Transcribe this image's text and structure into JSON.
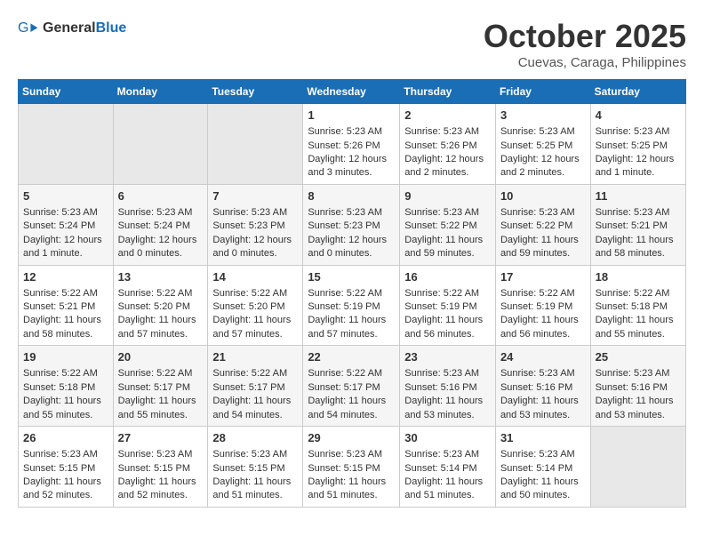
{
  "logo": {
    "general": "General",
    "blue": "Blue"
  },
  "header": {
    "month": "October 2025",
    "location": "Cuevas, Caraga, Philippines"
  },
  "weekdays": [
    "Sunday",
    "Monday",
    "Tuesday",
    "Wednesday",
    "Thursday",
    "Friday",
    "Saturday"
  ],
  "weeks": [
    [
      {
        "day": "",
        "empty": true
      },
      {
        "day": "",
        "empty": true
      },
      {
        "day": "",
        "empty": true
      },
      {
        "day": "1",
        "sunrise": "Sunrise: 5:23 AM",
        "sunset": "Sunset: 5:26 PM",
        "daylight": "Daylight: 12 hours and 3 minutes."
      },
      {
        "day": "2",
        "sunrise": "Sunrise: 5:23 AM",
        "sunset": "Sunset: 5:26 PM",
        "daylight": "Daylight: 12 hours and 2 minutes."
      },
      {
        "day": "3",
        "sunrise": "Sunrise: 5:23 AM",
        "sunset": "Sunset: 5:25 PM",
        "daylight": "Daylight: 12 hours and 2 minutes."
      },
      {
        "day": "4",
        "sunrise": "Sunrise: 5:23 AM",
        "sunset": "Sunset: 5:25 PM",
        "daylight": "Daylight: 12 hours and 1 minute."
      }
    ],
    [
      {
        "day": "5",
        "sunrise": "Sunrise: 5:23 AM",
        "sunset": "Sunset: 5:24 PM",
        "daylight": "Daylight: 12 hours and 1 minute."
      },
      {
        "day": "6",
        "sunrise": "Sunrise: 5:23 AM",
        "sunset": "Sunset: 5:24 PM",
        "daylight": "Daylight: 12 hours and 0 minutes."
      },
      {
        "day": "7",
        "sunrise": "Sunrise: 5:23 AM",
        "sunset": "Sunset: 5:23 PM",
        "daylight": "Daylight: 12 hours and 0 minutes."
      },
      {
        "day": "8",
        "sunrise": "Sunrise: 5:23 AM",
        "sunset": "Sunset: 5:23 PM",
        "daylight": "Daylight: 12 hours and 0 minutes."
      },
      {
        "day": "9",
        "sunrise": "Sunrise: 5:23 AM",
        "sunset": "Sunset: 5:22 PM",
        "daylight": "Daylight: 11 hours and 59 minutes."
      },
      {
        "day": "10",
        "sunrise": "Sunrise: 5:23 AM",
        "sunset": "Sunset: 5:22 PM",
        "daylight": "Daylight: 11 hours and 59 minutes."
      },
      {
        "day": "11",
        "sunrise": "Sunrise: 5:23 AM",
        "sunset": "Sunset: 5:21 PM",
        "daylight": "Daylight: 11 hours and 58 minutes."
      }
    ],
    [
      {
        "day": "12",
        "sunrise": "Sunrise: 5:22 AM",
        "sunset": "Sunset: 5:21 PM",
        "daylight": "Daylight: 11 hours and 58 minutes."
      },
      {
        "day": "13",
        "sunrise": "Sunrise: 5:22 AM",
        "sunset": "Sunset: 5:20 PM",
        "daylight": "Daylight: 11 hours and 57 minutes."
      },
      {
        "day": "14",
        "sunrise": "Sunrise: 5:22 AM",
        "sunset": "Sunset: 5:20 PM",
        "daylight": "Daylight: 11 hours and 57 minutes."
      },
      {
        "day": "15",
        "sunrise": "Sunrise: 5:22 AM",
        "sunset": "Sunset: 5:19 PM",
        "daylight": "Daylight: 11 hours and 57 minutes."
      },
      {
        "day": "16",
        "sunrise": "Sunrise: 5:22 AM",
        "sunset": "Sunset: 5:19 PM",
        "daylight": "Daylight: 11 hours and 56 minutes."
      },
      {
        "day": "17",
        "sunrise": "Sunrise: 5:22 AM",
        "sunset": "Sunset: 5:19 PM",
        "daylight": "Daylight: 11 hours and 56 minutes."
      },
      {
        "day": "18",
        "sunrise": "Sunrise: 5:22 AM",
        "sunset": "Sunset: 5:18 PM",
        "daylight": "Daylight: 11 hours and 55 minutes."
      }
    ],
    [
      {
        "day": "19",
        "sunrise": "Sunrise: 5:22 AM",
        "sunset": "Sunset: 5:18 PM",
        "daylight": "Daylight: 11 hours and 55 minutes."
      },
      {
        "day": "20",
        "sunrise": "Sunrise: 5:22 AM",
        "sunset": "Sunset: 5:17 PM",
        "daylight": "Daylight: 11 hours and 55 minutes."
      },
      {
        "day": "21",
        "sunrise": "Sunrise: 5:22 AM",
        "sunset": "Sunset: 5:17 PM",
        "daylight": "Daylight: 11 hours and 54 minutes."
      },
      {
        "day": "22",
        "sunrise": "Sunrise: 5:22 AM",
        "sunset": "Sunset: 5:17 PM",
        "daylight": "Daylight: 11 hours and 54 minutes."
      },
      {
        "day": "23",
        "sunrise": "Sunrise: 5:23 AM",
        "sunset": "Sunset: 5:16 PM",
        "daylight": "Daylight: 11 hours and 53 minutes."
      },
      {
        "day": "24",
        "sunrise": "Sunrise: 5:23 AM",
        "sunset": "Sunset: 5:16 PM",
        "daylight": "Daylight: 11 hours and 53 minutes."
      },
      {
        "day": "25",
        "sunrise": "Sunrise: 5:23 AM",
        "sunset": "Sunset: 5:16 PM",
        "daylight": "Daylight: 11 hours and 53 minutes."
      }
    ],
    [
      {
        "day": "26",
        "sunrise": "Sunrise: 5:23 AM",
        "sunset": "Sunset: 5:15 PM",
        "daylight": "Daylight: 11 hours and 52 minutes."
      },
      {
        "day": "27",
        "sunrise": "Sunrise: 5:23 AM",
        "sunset": "Sunset: 5:15 PM",
        "daylight": "Daylight: 11 hours and 52 minutes."
      },
      {
        "day": "28",
        "sunrise": "Sunrise: 5:23 AM",
        "sunset": "Sunset: 5:15 PM",
        "daylight": "Daylight: 11 hours and 51 minutes."
      },
      {
        "day": "29",
        "sunrise": "Sunrise: 5:23 AM",
        "sunset": "Sunset: 5:15 PM",
        "daylight": "Daylight: 11 hours and 51 minutes."
      },
      {
        "day": "30",
        "sunrise": "Sunrise: 5:23 AM",
        "sunset": "Sunset: 5:14 PM",
        "daylight": "Daylight: 11 hours and 51 minutes."
      },
      {
        "day": "31",
        "sunrise": "Sunrise: 5:23 AM",
        "sunset": "Sunset: 5:14 PM",
        "daylight": "Daylight: 11 hours and 50 minutes."
      },
      {
        "day": "",
        "empty": true
      }
    ]
  ]
}
